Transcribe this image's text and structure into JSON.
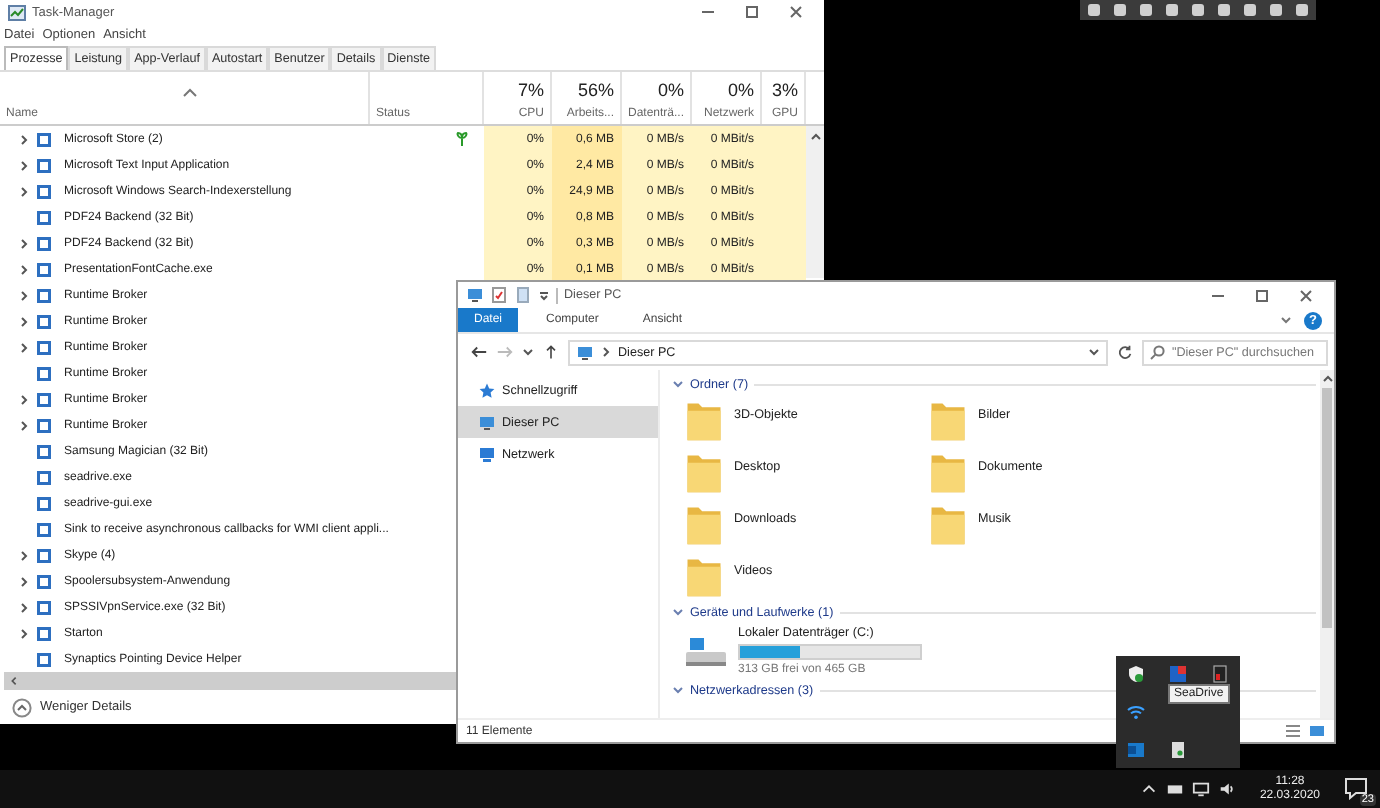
{
  "task_manager": {
    "title": "Task-Manager",
    "menu": [
      "Datei",
      "Optionen",
      "Ansicht"
    ],
    "tabs": [
      {
        "label": "Prozesse",
        "selected": true
      },
      {
        "label": "Leistung",
        "selected": false
      },
      {
        "label": "App-Verlauf",
        "selected": false
      },
      {
        "label": "Autostart",
        "selected": false
      },
      {
        "label": "Benutzer",
        "selected": false
      },
      {
        "label": "Details",
        "selected": false
      },
      {
        "label": "Dienste",
        "selected": false
      }
    ],
    "columns": [
      {
        "label": "Name"
      },
      {
        "label": "Status"
      },
      {
        "usage": "7%",
        "label": "CPU"
      },
      {
        "usage": "56%",
        "label": "Arbeits..."
      },
      {
        "usage": "0%",
        "label": "Datenträ..."
      },
      {
        "usage": "0%",
        "label": "Netzwerk"
      },
      {
        "usage": "3%",
        "label": "GPU"
      }
    ],
    "rows": [
      {
        "name": "Microsoft Store (2)",
        "expandable": true,
        "suspended": true,
        "values": [
          "0%",
          "0,6 MB",
          "0 MB/s",
          "0 MBit/s"
        ]
      },
      {
        "name": "Microsoft Text Input Application",
        "expandable": true,
        "suspended": false,
        "values": [
          "0%",
          "2,4 MB",
          "0 MB/s",
          "0 MBit/s"
        ]
      },
      {
        "name": "Microsoft Windows Search-Indexerstellung",
        "expandable": true,
        "suspended": false,
        "values": [
          "0%",
          "24,9 MB",
          "0 MB/s",
          "0 MBit/s"
        ]
      },
      {
        "name": "PDF24 Backend (32 Bit)",
        "expandable": false,
        "suspended": false,
        "values": [
          "0%",
          "0,8 MB",
          "0 MB/s",
          "0 MBit/s"
        ]
      },
      {
        "name": "PDF24 Backend (32 Bit)",
        "expandable": true,
        "suspended": false,
        "values": [
          "0%",
          "0,3 MB",
          "0 MB/s",
          "0 MBit/s"
        ]
      },
      {
        "name": "PresentationFontCache.exe",
        "expandable": true,
        "suspended": false,
        "values": [
          "0%",
          "0,1 MB",
          "0 MB/s",
          "0 MBit/s"
        ]
      },
      {
        "name": "Runtime Broker",
        "expandable": true,
        "suspended": false
      },
      {
        "name": "Runtime Broker",
        "expandable": true,
        "suspended": false
      },
      {
        "name": "Runtime Broker",
        "expandable": true,
        "suspended": false
      },
      {
        "name": "Runtime Broker",
        "expandable": false,
        "suspended": false
      },
      {
        "name": "Runtime Broker",
        "expandable": true,
        "suspended": false
      },
      {
        "name": "Runtime Broker",
        "expandable": true,
        "suspended": false
      },
      {
        "name": "Samsung Magician (32 Bit)",
        "expandable": false,
        "suspended": false
      },
      {
        "name": "seadrive.exe",
        "expandable": false,
        "suspended": false
      },
      {
        "name": "seadrive-gui.exe",
        "expandable": false,
        "suspended": false
      },
      {
        "name": "Sink to receive asynchronous callbacks for WMI client appli...",
        "expandable": false,
        "suspended": false
      },
      {
        "name": "Skype (4)",
        "expandable": true,
        "suspended": false
      },
      {
        "name": "Spoolersubsystem-Anwendung",
        "expandable": true,
        "suspended": false
      },
      {
        "name": "SPSSIVpnService.exe (32 Bit)",
        "expandable": true,
        "suspended": false
      },
      {
        "name": "Starton",
        "expandable": true,
        "suspended": false
      },
      {
        "name": "Synaptics Pointing Device Helper",
        "expandable": false,
        "suspended": false
      }
    ],
    "footer": "Weniger Details"
  },
  "explorer": {
    "title": "Dieser PC",
    "ribbon_tabs": [
      {
        "label": "Datei",
        "selected": true
      },
      {
        "label": "Computer",
        "selected": false
      },
      {
        "label": "Ansicht",
        "selected": false
      }
    ],
    "help": "?",
    "address": "Dieser PC",
    "search": {
      "placeholder": "\"Dieser PC\" durchsuchen"
    },
    "nav": [
      {
        "label": "Schnellzugriff",
        "selected": false
      },
      {
        "label": "Dieser PC",
        "selected": true
      },
      {
        "label": "Netzwerk",
        "selected": false
      }
    ],
    "sections": [
      {
        "title": "Ordner (7)",
        "expanded": true,
        "items": [
          {
            "kind": "folder",
            "name": "3D-Objekte"
          },
          {
            "kind": "folder",
            "name": "Bilder"
          },
          {
            "kind": "folder",
            "name": "Desktop"
          },
          {
            "kind": "folder",
            "name": "Dokumente"
          },
          {
            "kind": "folder",
            "name": "Downloads"
          },
          {
            "kind": "folder",
            "name": "Musik"
          },
          {
            "kind": "folder",
            "name": "Videos"
          }
        ]
      },
      {
        "title": "Geräte und Laufwerke (1)",
        "expanded": true,
        "items": [
          {
            "kind": "drive",
            "name": "Lokaler Datenträger (C:)",
            "level": 0.33,
            "detail": "313 GB frei von 465 GB"
          }
        ]
      },
      {
        "title": "Netzwerkadressen (3)",
        "expanded": true
      }
    ],
    "status": "11 Elemente"
  },
  "tray_popup": {
    "tooltip": "SeaDrive"
  },
  "taskbar": {
    "time": "11:28",
    "date": "22.03.2020",
    "notifications": "23"
  }
}
